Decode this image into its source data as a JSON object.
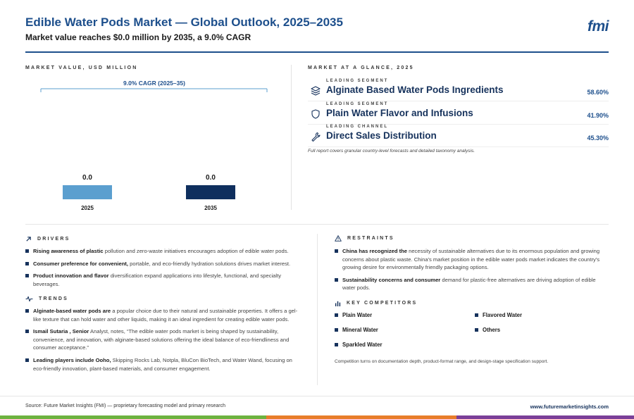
{
  "header": {
    "title": "Edible Water Pods Market — Global Outlook, 2025–2035",
    "subtitle": "Market value reaches $0.0 million by 2035, a 9.0% CAGR",
    "logo": "fmi"
  },
  "chart_section_label": "MARKET VALUE, USD MILLION",
  "chart_data": {
    "type": "bar",
    "categories": [
      "2025",
      "2035"
    ],
    "values": [
      0.0,
      0.0
    ],
    "value_labels": [
      "0.0",
      "0.0"
    ],
    "annotation": "9.0% CAGR (2025–35)",
    "bar_colors": [
      "#5b9fcf",
      "#0f2f5e"
    ]
  },
  "glance": {
    "label": "MARKET AT A GLANCE, 2025",
    "items": [
      {
        "kicker": "LEADING SEGMENT",
        "name": "Alginate Based Water Pods Ingredients",
        "pct": "58.60%",
        "icon": "layers-icon"
      },
      {
        "kicker": "LEADING SEGMENT",
        "name": "Plain Water Flavor and Infusions",
        "pct": "41.90%",
        "icon": "shield-icon"
      },
      {
        "kicker": "LEADING CHANNEL",
        "name": "Direct Sales Distribution",
        "pct": "45.30%",
        "icon": "wrench-icon"
      }
    ],
    "note": "Full report covers granular country-level forecasts and detailed taxonomy analysis."
  },
  "drivers": {
    "label": "DRIVERS",
    "items": [
      {
        "bold": "Rising awareness of plastic",
        "text": " pollution and zero-waste initiatives encourages adoption of edible water pods."
      },
      {
        "bold": "Consumer preference for convenient,",
        "text": " portable, and eco-friendly hydration solutions drives market interest."
      },
      {
        "bold": "Product innovation and flavor",
        "text": " diversification expand applications into lifestyle, functional, and specialty beverages."
      }
    ]
  },
  "trends": {
    "label": "TRENDS",
    "items": [
      {
        "bold": "Alginate-based water pods are",
        "text": " a popular choice due to their natural and sustainable properties. It offers a gel-like texture that can hold water and other liquids, making it an ideal ingredient for creating edible water pods."
      },
      {
        "bold": "Ismail Sutaria , Senior",
        "text": " Analyst, notes, “The edible water pods market is being shaped by sustainability, convenience, and innovation, with alginate-based solutions offering the ideal balance of eco-friendliness and consumer acceptance.”"
      },
      {
        "bold": "Leading players include Ooho,",
        "text": " Skipping Rocks Lab, Notpla, BluCon BioTech, and Water Wand, focusing on eco-friendly innovation, plant-based materials, and consumer engagement."
      }
    ]
  },
  "restraints": {
    "label": "RESTRAINTS",
    "items": [
      {
        "bold": "China has recognized the",
        "text": " necessity of sustainable alternatives due to its enormous population and growing concerns about plastic waste. China's market position in the edible water pods market indicates the country's growing desire for environmentally friendly packaging options."
      },
      {
        "bold": "Sustainability concerns and consumer",
        "text": " demand for plastic-free alternatives are driving adoption of edible water pods."
      }
    ]
  },
  "competitors": {
    "label": "KEY COMPETITORS",
    "items": [
      "Plain Water",
      "Flavored Water",
      "Mineral Water",
      "Others",
      "Sparkled Water"
    ],
    "note": "Competition turns on documentation depth, product-format range, and design-stage specification support."
  },
  "footer": {
    "source": "Source: Future Market Insights (FMI) — proprietary forecasting model and primary research",
    "site": "www.futuremarketinsights.com"
  },
  "colors": {
    "brand": "#1d4f8c",
    "navy": "#16325c",
    "stripe_green": "#6db33f",
    "stripe_orange": "#e87d2a",
    "stripe_purple": "#7b3f98"
  }
}
